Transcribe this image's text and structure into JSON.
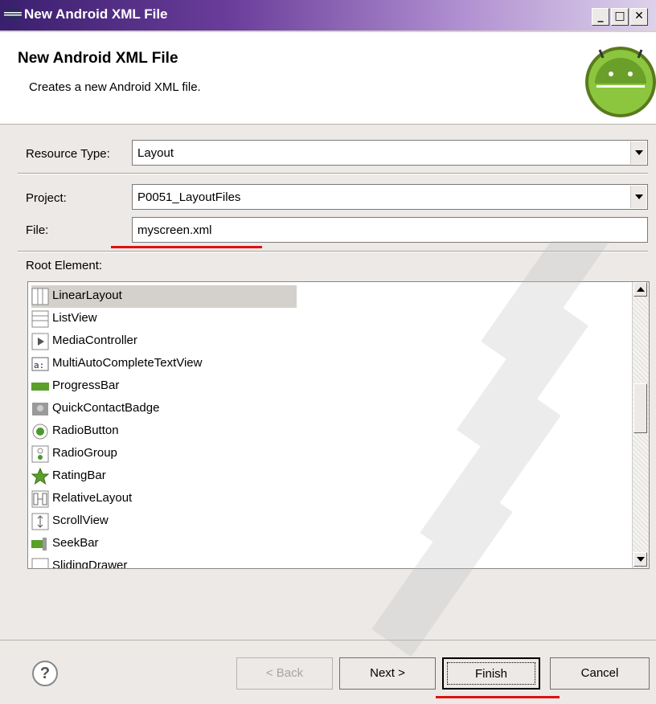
{
  "window": {
    "title": "New Android XML File"
  },
  "header": {
    "title": "New Android XML File",
    "description": "Creates a new Android XML file."
  },
  "form": {
    "resource_type_label": "Resource Type:",
    "resource_type_value": "Layout",
    "project_label": "Project:",
    "project_value": "P0051_LayoutFiles",
    "file_label": "File:",
    "file_value": "myscreen.xml",
    "root_element_label": "Root Element:"
  },
  "root_elements": [
    {
      "label": "LinearLayout",
      "icon": "linear-layout-icon",
      "selected": true
    },
    {
      "label": "ListView",
      "icon": "list-view-icon"
    },
    {
      "label": "MediaController",
      "icon": "media-controller-icon"
    },
    {
      "label": "MultiAutoCompleteTextView",
      "icon": "autocomplete-icon"
    },
    {
      "label": "ProgressBar",
      "icon": "progress-bar-icon"
    },
    {
      "label": "QuickContactBadge",
      "icon": "contact-badge-icon"
    },
    {
      "label": "RadioButton",
      "icon": "radio-button-icon"
    },
    {
      "label": "RadioGroup",
      "icon": "radio-group-icon"
    },
    {
      "label": "RatingBar",
      "icon": "star-icon"
    },
    {
      "label": "RelativeLayout",
      "icon": "relative-layout-icon"
    },
    {
      "label": "ScrollView",
      "icon": "scroll-view-icon"
    },
    {
      "label": "SeekBar",
      "icon": "seek-bar-icon"
    },
    {
      "label": "SlidingDrawer",
      "icon": "sliding-drawer-icon"
    }
  ],
  "buttons": {
    "help": "?",
    "back": "< Back",
    "next": "Next >",
    "finish": "Finish",
    "cancel": "Cancel"
  },
  "colors": {
    "accent_underline": "#e01010",
    "title_bar": "#3a1f6e"
  }
}
